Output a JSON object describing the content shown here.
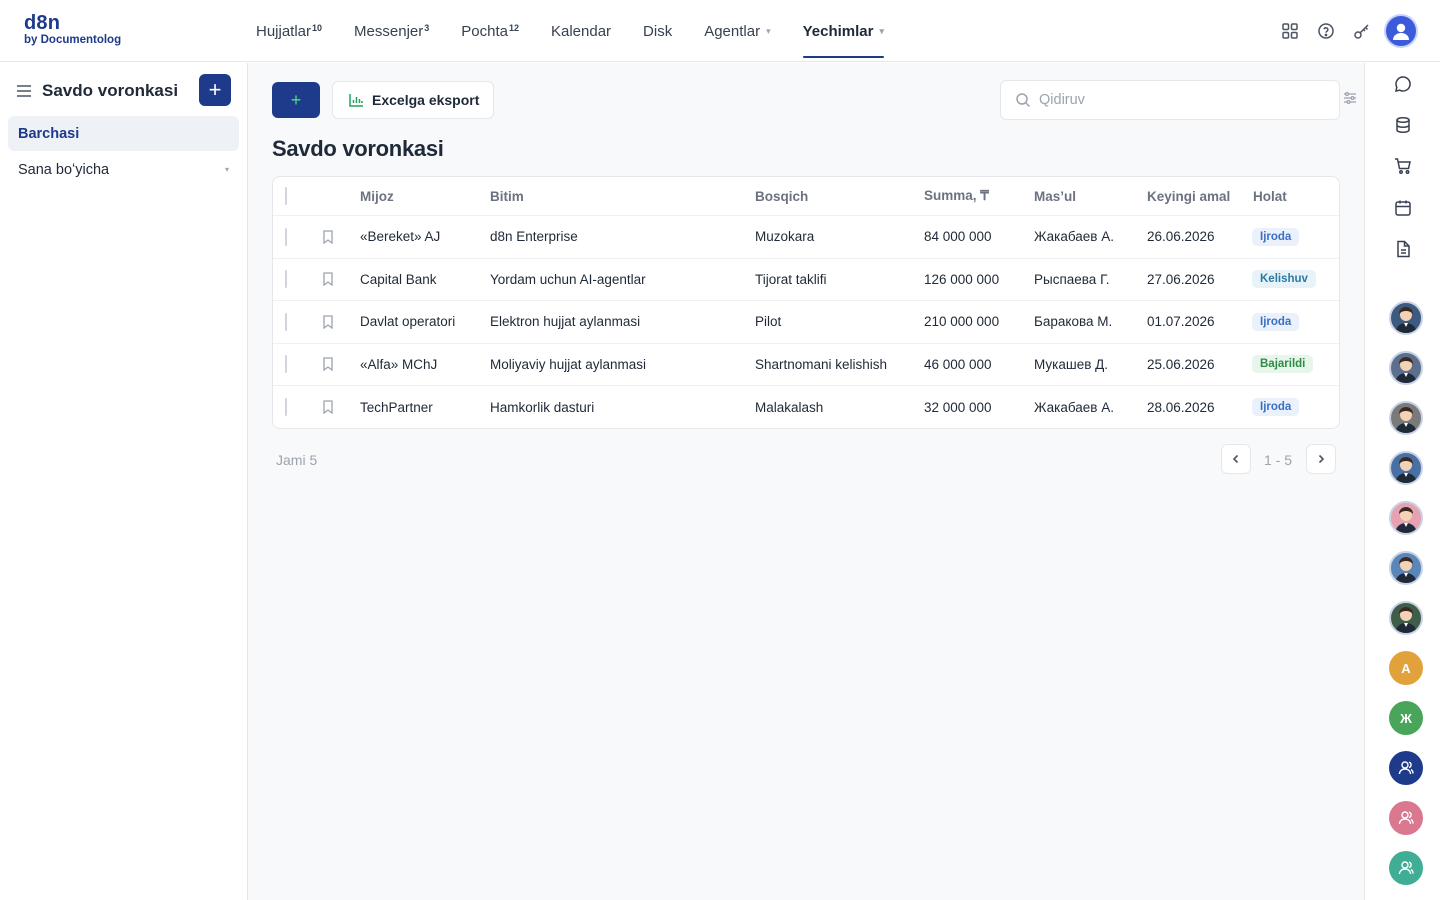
{
  "brand": {
    "line1": "d8n",
    "line2": "by Documentolog"
  },
  "nav": [
    {
      "label": "Hujjatlar",
      "count": "10"
    },
    {
      "label": "Messenjer",
      "count": "3"
    },
    {
      "label": "Pochta",
      "count": "12"
    },
    {
      "label": "Kalendar",
      "count": ""
    },
    {
      "label": "Disk",
      "count": ""
    },
    {
      "label": "Agentlar",
      "count": ""
    },
    {
      "label": "Yechimlar",
      "count": ""
    }
  ],
  "active_nav": "Yechimlar",
  "sidebar": {
    "title": "Savdo voronkasi",
    "add_label": "+",
    "items": [
      {
        "label": "Barchasi"
      },
      {
        "label": "Sana boʻyicha"
      }
    ]
  },
  "toolbar": {
    "add_label": "+",
    "export_label": "Excelga eksport",
    "search_placeholder": "Qidiruv"
  },
  "page_title": "Savdo voronkasi",
  "table": {
    "columns": [
      "Mijoz",
      "Bitim",
      "Bosqich",
      "Summa, ₸",
      "Mas’ul",
      "Keyingi amal",
      "Holat"
    ],
    "rows": [
      [
        "«Bereket» AJ",
        "d8n Enterprise",
        "Muzokara",
        "84 000 000",
        "Жакабаев А.",
        "26.06.2026",
        "Ijroda"
      ],
      [
        "Capital Bank",
        "Yordam uchun AI-agentlar",
        "Tijorat taklifi",
        "126 000 000",
        "Рыспаева Г.",
        "27.06.2026",
        "Kelishuv"
      ],
      [
        "Davlat operatori",
        "Elektron hujjat aylanmasi",
        "Pilot",
        "210 000 000",
        "Баракова М.",
        "01.07.2026",
        "Ijroda"
      ],
      [
        "«Alfa» MChJ",
        "Moliyaviy hujjat aylanmasi",
        "Shartnomani kelishish",
        "46 000 000",
        "Мукашев Д.",
        "25.06.2026",
        "Bajarildi"
      ],
      [
        "TechPartner",
        "Hamkorlik dasturi",
        "Malakalash",
        "32 000 000",
        "Жакабаев А.",
        "28.06.2026",
        "Ijroda"
      ]
    ]
  },
  "status_colors": {
    "Ijroda": {
      "bg": "#eaf1fb",
      "fg": "#3b6fc4"
    },
    "Kelishuv": {
      "bg": "#e7f3f8",
      "fg": "#2a7aa5"
    },
    "Bajarildi": {
      "bg": "#e6f6ea",
      "fg": "#2f8a46"
    }
  },
  "pager": {
    "total": "Jami 5",
    "range": "1 - 5"
  },
  "rail": {
    "icons": [
      "chat-icon",
      "database-icon",
      "cart-icon",
      "calendar-icon",
      "document-icon"
    ],
    "avatars": [
      {
        "type": "photo",
        "color": "#3d5a80"
      },
      {
        "type": "photo",
        "color": "#5c6f8c"
      },
      {
        "type": "photo",
        "color": "#7a7a7a"
      },
      {
        "type": "photo",
        "color": "#4a6fa5"
      },
      {
        "type": "photo",
        "color": "#e7a1b0"
      },
      {
        "type": "photo",
        "color": "#5b86b8"
      },
      {
        "type": "photo",
        "color": "#3e5e4a"
      },
      {
        "type": "letter",
        "letter": "A",
        "color": "#e2a23b"
      },
      {
        "type": "letter",
        "letter": "Ж",
        "color": "#48a55a"
      },
      {
        "type": "group",
        "color": "#1e3a8a"
      },
      {
        "type": "group",
        "color": "#d9788f"
      },
      {
        "type": "group",
        "color": "#3fae94"
      }
    ]
  },
  "colors": {
    "accent": "#1e3a8a",
    "export_icon": "#22a35b"
  }
}
